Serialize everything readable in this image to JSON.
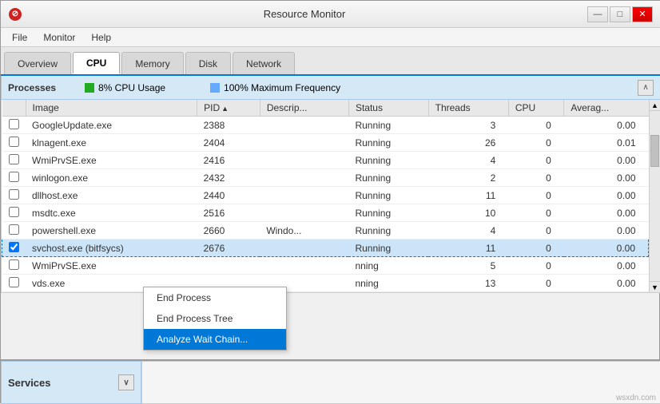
{
  "titleBar": {
    "title": "Resource Monitor",
    "icon": "⊘"
  },
  "menu": {
    "items": [
      "File",
      "Monitor",
      "Help"
    ]
  },
  "tabs": [
    {
      "label": "Overview",
      "active": false
    },
    {
      "label": "CPU",
      "active": true
    },
    {
      "label": "Memory",
      "active": false
    },
    {
      "label": "Disk",
      "active": false
    },
    {
      "label": "Network",
      "active": false
    }
  ],
  "processesSection": {
    "title": "Processes",
    "cpuUsage": "8% CPU Usage",
    "maxFrequency": "100% Maximum Frequency"
  },
  "tableHeaders": [
    "",
    "Image",
    "PID",
    "Descrip...",
    "Status",
    "Threads",
    "CPU",
    "Averag..."
  ],
  "processes": [
    {
      "image": "GoogleUpdate.exe",
      "pid": "2388",
      "desc": "",
      "status": "Running",
      "threads": "3",
      "cpu": "0",
      "avg": "0.00"
    },
    {
      "image": "klnagent.exe",
      "pid": "2404",
      "desc": "",
      "status": "Running",
      "threads": "26",
      "cpu": "0",
      "avg": "0.01"
    },
    {
      "image": "WmiPrvSE.exe",
      "pid": "2416",
      "desc": "",
      "status": "Running",
      "threads": "4",
      "cpu": "0",
      "avg": "0.00"
    },
    {
      "image": "winlogon.exe",
      "pid": "2432",
      "desc": "",
      "status": "Running",
      "threads": "2",
      "cpu": "0",
      "avg": "0.00"
    },
    {
      "image": "dllhost.exe",
      "pid": "2440",
      "desc": "",
      "status": "Running",
      "threads": "11",
      "cpu": "0",
      "avg": "0.00"
    },
    {
      "image": "msdtc.exe",
      "pid": "2516",
      "desc": "",
      "status": "Running",
      "threads": "10",
      "cpu": "0",
      "avg": "0.00"
    },
    {
      "image": "powershell.exe",
      "pid": "2660",
      "desc": "Windo...",
      "status": "Running",
      "threads": "4",
      "cpu": "0",
      "avg": "0.00"
    },
    {
      "image": "svchost.exe (bitfsycs)",
      "pid": "2676",
      "desc": "",
      "status": "Running",
      "threads": "11",
      "cpu": "0",
      "avg": "0.00",
      "selected": true
    },
    {
      "image": "WmiPrvSE.exe",
      "pid": "",
      "desc": "",
      "status": "nning",
      "threads": "5",
      "cpu": "0",
      "avg": "0.00"
    },
    {
      "image": "vds.exe",
      "pid": "",
      "desc": "",
      "status": "nning",
      "threads": "13",
      "cpu": "0",
      "avg": "0.00"
    }
  ],
  "contextMenu": {
    "items": [
      {
        "label": "End Process",
        "highlighted": false
      },
      {
        "label": "End Process Tree",
        "highlighted": false
      },
      {
        "label": "Analyze Wait Chain...",
        "highlighted": true
      }
    ]
  },
  "servicesSection": {
    "title": "Services"
  },
  "watermark": "wsxdn.com"
}
